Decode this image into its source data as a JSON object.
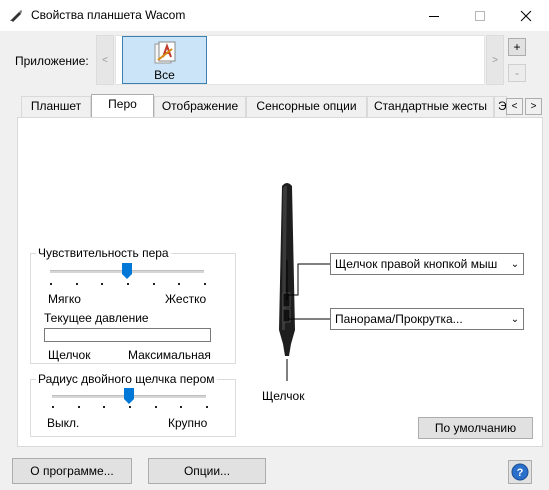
{
  "window": {
    "title": "Свойства планшета Wacom"
  },
  "application": {
    "label": "Приложение:",
    "items": [
      {
        "label": "Все"
      }
    ]
  },
  "tabs": [
    {
      "label": "Планшет"
    },
    {
      "label": "Перо"
    },
    {
      "label": "Отображение"
    },
    {
      "label": "Сенсорные опции"
    },
    {
      "label": "Стандартные жесты"
    },
    {
      "label": "Экр"
    }
  ],
  "pen": {
    "sensitivity": {
      "title": "Чувствительность пера",
      "min_label": "Мягко",
      "max_label": "Жестко",
      "level": 0.5,
      "current_pressure_label": "Текущее давление",
      "click_label": "Щелчок",
      "max_pressure_label": "Максимальная"
    },
    "double_click": {
      "title": "Радиус двойного щелчка пером",
      "min_label": "Выкл.",
      "max_label": "Крупно",
      "level": 0.5
    },
    "button_upper": "Щелчок правой кнопкой мыш",
    "button_lower": "Панорама/Прокрутка...",
    "tip_label": "Щелчок",
    "default_button": "По умолчанию"
  },
  "footer": {
    "about_button": "О программе...",
    "options_button": "Опции..."
  },
  "colors": {
    "accent": "#0078d7",
    "selection": "#cce4f7"
  }
}
